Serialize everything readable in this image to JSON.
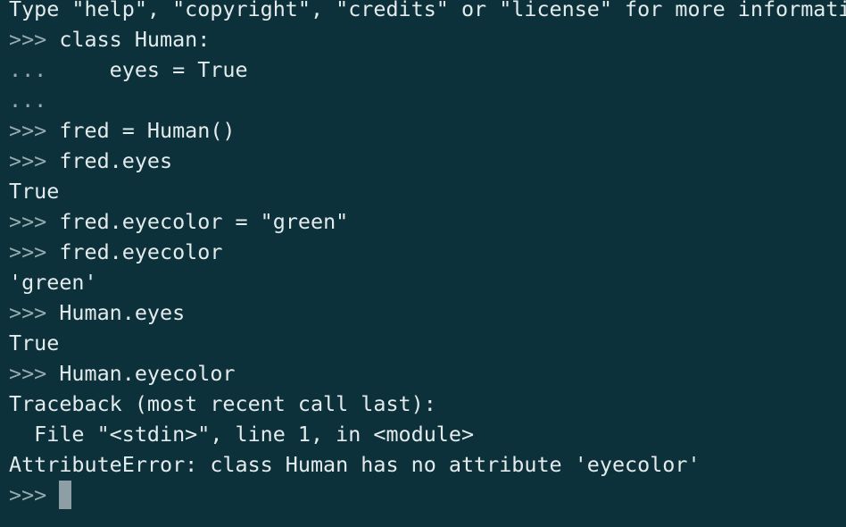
{
  "terminal": {
    "colors": {
      "background": "#0c313b",
      "text": "#e3ebec",
      "prompt": "#98abb0",
      "cursor": "#8d9fa4"
    },
    "lines": [
      {
        "prompt": "",
        "text": "Type \"help\", \"copyright\", \"credits\" or \"license\" for more informati"
      },
      {
        "prompt": ">>> ",
        "text": "class Human:"
      },
      {
        "prompt": "... ",
        "text": "    eyes = True"
      },
      {
        "prompt": "...",
        "text": ""
      },
      {
        "prompt": ">>> ",
        "text": "fred = Human()"
      },
      {
        "prompt": ">>> ",
        "text": "fred.eyes"
      },
      {
        "prompt": "",
        "text": "True"
      },
      {
        "prompt": ">>> ",
        "text": "fred.eyecolor = \"green\""
      },
      {
        "prompt": ">>> ",
        "text": "fred.eyecolor"
      },
      {
        "prompt": "",
        "text": "'green'"
      },
      {
        "prompt": ">>> ",
        "text": "Human.eyes"
      },
      {
        "prompt": "",
        "text": "True"
      },
      {
        "prompt": ">>> ",
        "text": "Human.eyecolor"
      },
      {
        "prompt": "",
        "text": "Traceback (most recent call last):"
      },
      {
        "prompt": "",
        "text": "  File \"<stdin>\", line 1, in <module>"
      },
      {
        "prompt": "",
        "text": "AttributeError: class Human has no attribute 'eyecolor'"
      }
    ],
    "current_prompt": ">>> "
  }
}
